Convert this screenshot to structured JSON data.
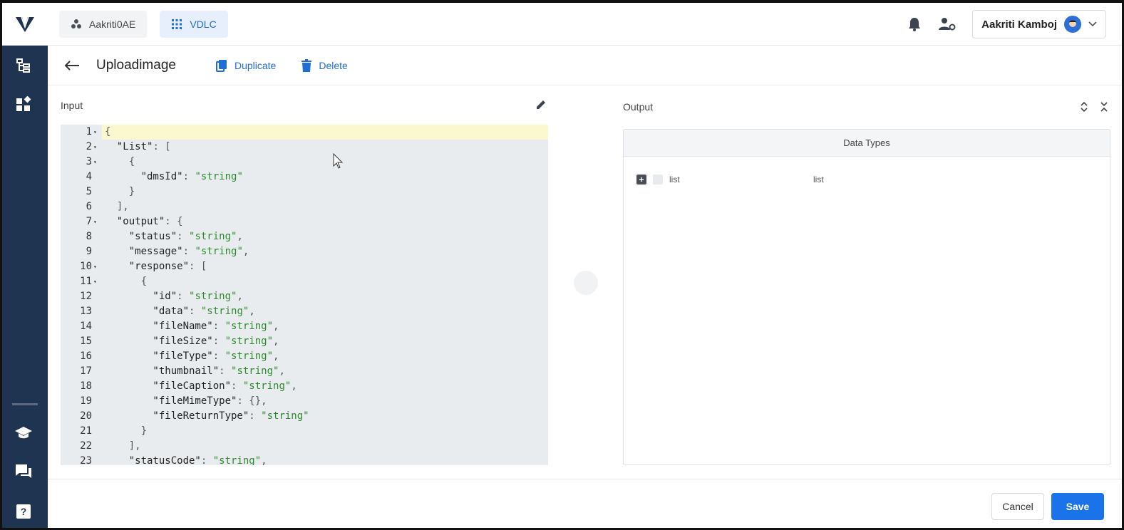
{
  "topbar": {
    "org_name": "Aakriti0AE",
    "app_name": "VDLC",
    "user_name": "Aakriti Kamboj"
  },
  "header": {
    "title": "Uploadimage",
    "duplicate_label": "Duplicate",
    "delete_label": "Delete"
  },
  "input_panel": {
    "label": "Input",
    "lines": [
      {
        "n": "1",
        "fold": true
      },
      {
        "n": "2",
        "fold": true
      },
      {
        "n": "3",
        "fold": true
      },
      {
        "n": "4",
        "fold": false
      },
      {
        "n": "5",
        "fold": false
      },
      {
        "n": "6",
        "fold": false
      },
      {
        "n": "7",
        "fold": true
      },
      {
        "n": "8",
        "fold": false
      },
      {
        "n": "9",
        "fold": false
      },
      {
        "n": "10",
        "fold": true
      },
      {
        "n": "11",
        "fold": true
      },
      {
        "n": "12",
        "fold": false
      },
      {
        "n": "13",
        "fold": false
      },
      {
        "n": "14",
        "fold": false
      },
      {
        "n": "15",
        "fold": false
      },
      {
        "n": "16",
        "fold": false
      },
      {
        "n": "17",
        "fold": false
      },
      {
        "n": "18",
        "fold": false
      },
      {
        "n": "19",
        "fold": false
      },
      {
        "n": "20",
        "fold": false
      },
      {
        "n": "21",
        "fold": false
      },
      {
        "n": "22",
        "fold": false
      },
      {
        "n": "23",
        "fold": false
      }
    ],
    "code": [
      [
        {
          "t": "{",
          "c": "p"
        }
      ],
      [
        {
          "t": "  \"List\"",
          "c": "k"
        },
        {
          "t": ": [",
          "c": "p"
        }
      ],
      [
        {
          "t": "    {",
          "c": "p"
        }
      ],
      [
        {
          "t": "      \"dmsId\"",
          "c": "k"
        },
        {
          "t": ": ",
          "c": "p"
        },
        {
          "t": "\"string\"",
          "c": "s"
        }
      ],
      [
        {
          "t": "    }",
          "c": "p"
        }
      ],
      [
        {
          "t": "  ],",
          "c": "p"
        }
      ],
      [
        {
          "t": "  \"output\"",
          "c": "k"
        },
        {
          "t": ": {",
          "c": "p"
        }
      ],
      [
        {
          "t": "    \"status\"",
          "c": "k"
        },
        {
          "t": ": ",
          "c": "p"
        },
        {
          "t": "\"string\"",
          "c": "s"
        },
        {
          "t": ",",
          "c": "p"
        }
      ],
      [
        {
          "t": "    \"message\"",
          "c": "k"
        },
        {
          "t": ": ",
          "c": "p"
        },
        {
          "t": "\"string\"",
          "c": "s"
        },
        {
          "t": ",",
          "c": "p"
        }
      ],
      [
        {
          "t": "    \"response\"",
          "c": "k"
        },
        {
          "t": ": [",
          "c": "p"
        }
      ],
      [
        {
          "t": "      {",
          "c": "p"
        }
      ],
      [
        {
          "t": "        \"id\"",
          "c": "k"
        },
        {
          "t": ": ",
          "c": "p"
        },
        {
          "t": "\"string\"",
          "c": "s"
        },
        {
          "t": ",",
          "c": "p"
        }
      ],
      [
        {
          "t": "        \"data\"",
          "c": "k"
        },
        {
          "t": ": ",
          "c": "p"
        },
        {
          "t": "\"string\"",
          "c": "s"
        },
        {
          "t": ",",
          "c": "p"
        }
      ],
      [
        {
          "t": "        \"fileName\"",
          "c": "k"
        },
        {
          "t": ": ",
          "c": "p"
        },
        {
          "t": "\"string\"",
          "c": "s"
        },
        {
          "t": ",",
          "c": "p"
        }
      ],
      [
        {
          "t": "        \"fileSize\"",
          "c": "k"
        },
        {
          "t": ": ",
          "c": "p"
        },
        {
          "t": "\"string\"",
          "c": "s"
        },
        {
          "t": ",",
          "c": "p"
        }
      ],
      [
        {
          "t": "        \"fileType\"",
          "c": "k"
        },
        {
          "t": ": ",
          "c": "p"
        },
        {
          "t": "\"string\"",
          "c": "s"
        },
        {
          "t": ",",
          "c": "p"
        }
      ],
      [
        {
          "t": "        \"thumbnail\"",
          "c": "k"
        },
        {
          "t": ": ",
          "c": "p"
        },
        {
          "t": "\"string\"",
          "c": "s"
        },
        {
          "t": ",",
          "c": "p"
        }
      ],
      [
        {
          "t": "        \"fileCaption\"",
          "c": "k"
        },
        {
          "t": ": ",
          "c": "p"
        },
        {
          "t": "\"string\"",
          "c": "s"
        },
        {
          "t": ",",
          "c": "p"
        }
      ],
      [
        {
          "t": "        \"fileMimeType\"",
          "c": "k"
        },
        {
          "t": ": {},",
          "c": "p"
        }
      ],
      [
        {
          "t": "        \"fileReturnType\"",
          "c": "k"
        },
        {
          "t": ": ",
          "c": "p"
        },
        {
          "t": "\"string\"",
          "c": "s"
        }
      ],
      [
        {
          "t": "      }",
          "c": "p"
        }
      ],
      [
        {
          "t": "    ],",
          "c": "p"
        }
      ],
      [
        {
          "t": "    \"statusCode\"",
          "c": "k"
        },
        {
          "t": ": ",
          "c": "p"
        },
        {
          "t": "\"string\"",
          "c": "s"
        },
        {
          "t": ",",
          "c": "p"
        }
      ]
    ]
  },
  "output_panel": {
    "label": "Output",
    "table_header": "Data Types",
    "rows": [
      {
        "name": "list",
        "type": "list"
      }
    ]
  },
  "footer": {
    "cancel_label": "Cancel",
    "save_label": "Save"
  },
  "colors": {
    "sidebar_bg": "#1f3450",
    "accent": "#1a73e8",
    "string_green": "#2f8a2f",
    "active_line": "#fbf8cf"
  }
}
